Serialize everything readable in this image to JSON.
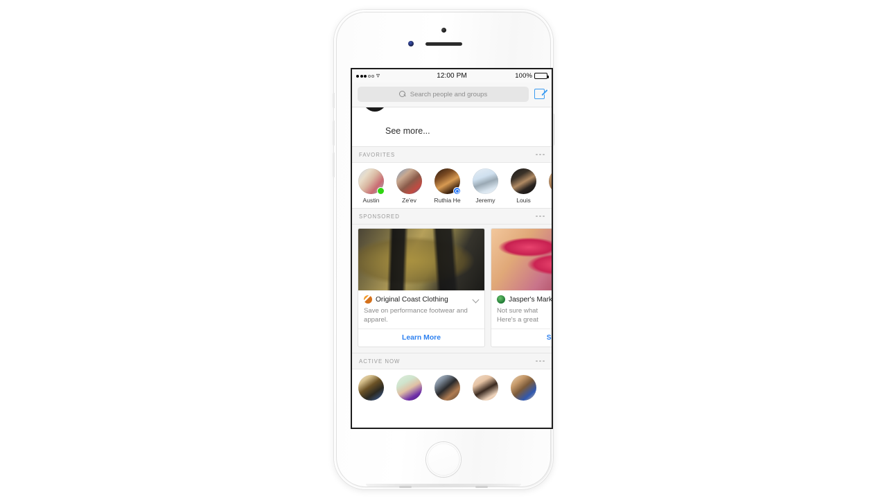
{
  "status_bar": {
    "signal_dots_filled": 3,
    "signal_dots_hollow": 2,
    "carrier_icon": "wifi-icon",
    "time": "12:00 PM",
    "battery_percent": "100%"
  },
  "search": {
    "placeholder": "Search people and groups",
    "icon": "search-icon",
    "compose_icon": "compose-icon"
  },
  "see_more": {
    "label": "See more..."
  },
  "sections": {
    "favorites": {
      "title": "FAVORITES",
      "more_icon": "kebab-menu-icon",
      "people": [
        {
          "name": "Austin",
          "badge": "online",
          "photo_class": "ph-austin"
        },
        {
          "name": "Ze'ev",
          "badge": "none",
          "photo_class": "ph-zeev"
        },
        {
          "name": "Ruthia He",
          "badge": "messenger",
          "photo_class": "ph-ruthia"
        },
        {
          "name": "Jeremy",
          "badge": "none",
          "photo_class": "ph-jeremy"
        },
        {
          "name": "Louis",
          "badge": "none",
          "photo_class": "ph-louis"
        }
      ]
    },
    "sponsored": {
      "title": "SPONSORED",
      "more_icon": "kebab-menu-icon",
      "ads": [
        {
          "advertiser": "Original Coast Clothing",
          "logo_icon": "coast-clothing-logo-icon",
          "image_alt": "sneakers-on-mossy-rock-photo",
          "description": "Save on performance footwear and apparel.",
          "cta": "Learn More",
          "chevron_icon": "chevron-down-icon"
        },
        {
          "advertiser": "Jasper's Market",
          "logo_icon": "jaspers-market-logo-icon",
          "image_alt": "sliced-figs-photo",
          "description_line1": "Not sure what",
          "description_line2": "Here's a great",
          "cta": "Sign",
          "chevron_icon": "chevron-down-icon"
        }
      ]
    },
    "active_now": {
      "title": "ACTIVE NOW",
      "more_icon": "kebab-menu-icon",
      "people_count": 5
    }
  },
  "colors": {
    "accent_blue": "#2e81f0",
    "online_green": "#2fd511",
    "messenger_blue": "#2e7bf6",
    "section_bg": "#f5f5f5",
    "section_label": "#9a9a9a"
  }
}
